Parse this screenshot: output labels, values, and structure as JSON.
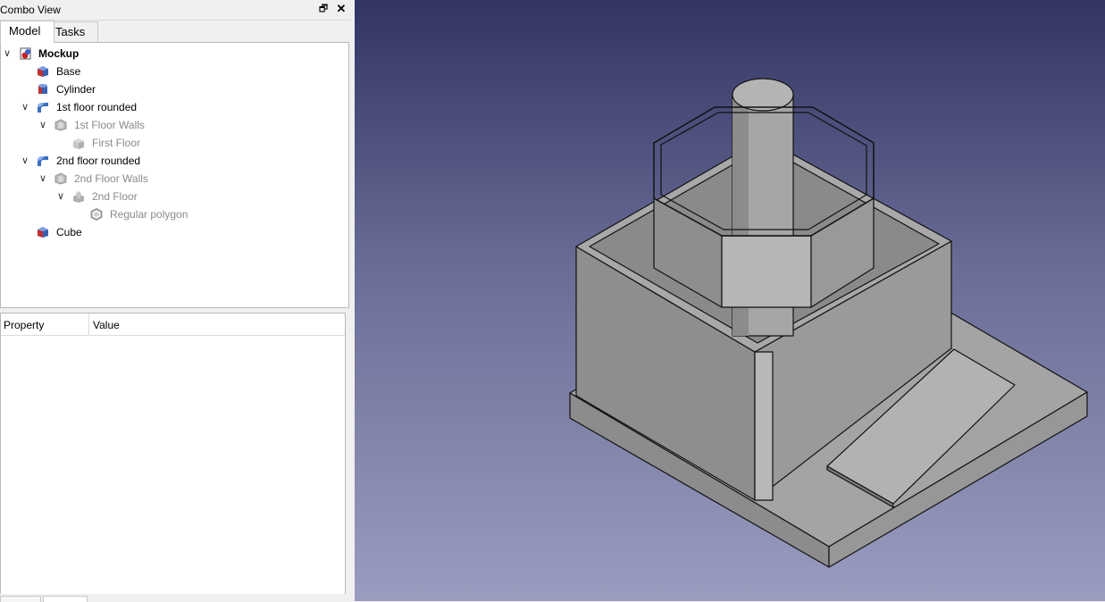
{
  "panel": {
    "title": "Combo View",
    "float_glyph": "🗗",
    "close_glyph": "✕"
  },
  "tabs": [
    {
      "label": "Model",
      "active": true
    },
    {
      "label": "Tasks",
      "active": false
    }
  ],
  "tree": [
    {
      "label": "Mockup",
      "icon": "document-icon",
      "expanded": true,
      "bold": true,
      "dim": false
    },
    {
      "label": "Base",
      "icon": "part-box-icon",
      "dim": false
    },
    {
      "label": "Cylinder",
      "icon": "part-cylinder-icon",
      "dim": false
    },
    {
      "label": "1st floor rounded",
      "icon": "fillet-icon",
      "expanded": true,
      "dim": false
    },
    {
      "label": "1st Floor Walls",
      "icon": "thickness-icon",
      "expanded": true,
      "dim": true
    },
    {
      "label": "First Floor",
      "icon": "extrude-icon",
      "dim": true
    },
    {
      "label": "2nd floor rounded",
      "icon": "fillet-icon",
      "expanded": true,
      "dim": false
    },
    {
      "label": "2nd Floor Walls",
      "icon": "thickness-icon",
      "expanded": true,
      "dim": true
    },
    {
      "label": "2nd Floor",
      "icon": "extrude-icon",
      "expanded": true,
      "dim": true
    },
    {
      "label": "Regular polygon",
      "icon": "polygon-icon",
      "dim": true
    },
    {
      "label": "Cube",
      "icon": "part-box-icon",
      "dim": false
    }
  ],
  "properties": {
    "col_property": "Property",
    "col_value": "Value"
  },
  "viewport": {
    "bg_top": "#323464",
    "bg_bottom": "#9a9cc0",
    "model_color": "#9c9c9c"
  }
}
